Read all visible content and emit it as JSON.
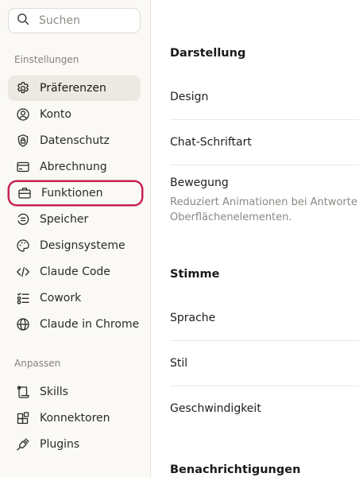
{
  "search": {
    "placeholder": "Suchen",
    "value": ""
  },
  "sidebar": {
    "settings_label": "Einstellungen",
    "settings_items": [
      {
        "label": "Präferenzen",
        "icon": "gear-icon",
        "active": true
      },
      {
        "label": "Konto",
        "icon": "user-circle-icon"
      },
      {
        "label": "Datenschutz",
        "icon": "shield-lock-icon"
      },
      {
        "label": "Abrechnung",
        "icon": "credit-card-icon"
      },
      {
        "label": "Funktionen",
        "icon": "briefcase-icon",
        "highlighted": true
      },
      {
        "label": "Speicher",
        "icon": "memory-icon"
      },
      {
        "label": "Designsysteme",
        "icon": "palette-icon"
      },
      {
        "label": "Claude Code",
        "icon": "code-icon"
      },
      {
        "label": "Cowork",
        "icon": "checklist-icon"
      },
      {
        "label": "Claude in Chrome",
        "icon": "globe-icon"
      }
    ],
    "customize_label": "Anpassen",
    "customize_items": [
      {
        "label": "Skills",
        "icon": "scroll-icon"
      },
      {
        "label": "Konnektoren",
        "icon": "blocks-icon"
      },
      {
        "label": "Plugins",
        "icon": "plug-icon"
      }
    ]
  },
  "main": {
    "appearance": {
      "title": "Darstellung",
      "design_label": "Design",
      "chat_font_label": "Chat-Schriftart",
      "motion_label": "Bewegung",
      "motion_desc": "Reduziert Animationen bei Antworte Oberflächenelementen."
    },
    "voice": {
      "title": "Stimme",
      "language_label": "Sprache",
      "style_label": "Stil",
      "speed_label": "Geschwindigkeit"
    },
    "notifications": {
      "title": "Benachrichtigungen"
    }
  },
  "colors": {
    "highlight_outline": "#c8234f",
    "active_background": "#ebe9e2",
    "sidebar_background": "#faf9f5"
  }
}
